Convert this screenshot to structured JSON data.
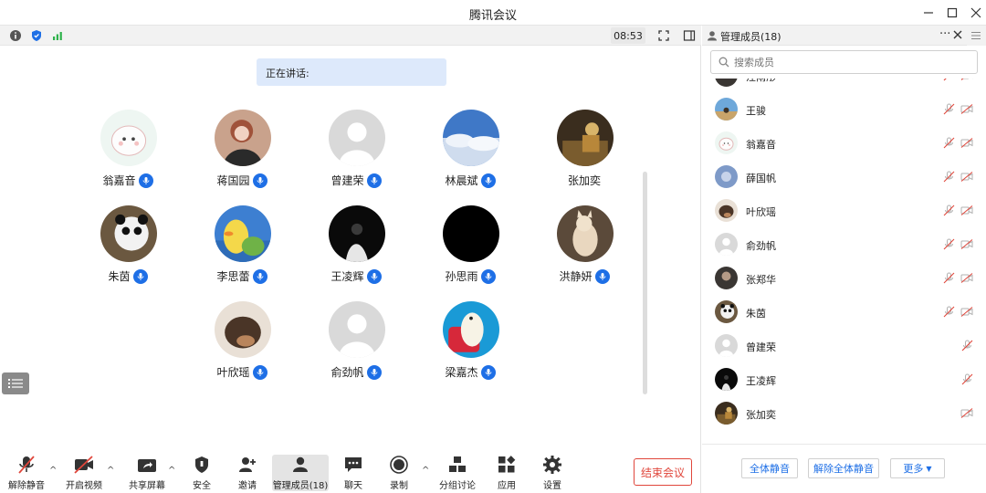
{
  "window": {
    "title": "腾讯会议"
  },
  "meeting": {
    "timer": "08:53",
    "speaking_label": "正在讲话:",
    "participants": [
      {
        "name": "翁嘉音",
        "mic": true,
        "avatar": "sheep"
      },
      {
        "name": "蒋国园",
        "mic": true,
        "avatar": "girl"
      },
      {
        "name": "曾建荣",
        "mic": true,
        "avatar": "default"
      },
      {
        "name": "林晨斌",
        "mic": true,
        "avatar": "clouds"
      },
      {
        "name": "张加奕",
        "mic": false,
        "avatar": "painting"
      },
      {
        "name": "朱茵",
        "mic": true,
        "avatar": "panda"
      },
      {
        "name": "李思蕾",
        "mic": true,
        "avatar": "duck"
      },
      {
        "name": "王凌辉",
        "mic": true,
        "avatar": "dark-person"
      },
      {
        "name": "孙思雨",
        "mic": true,
        "avatar": "black"
      },
      {
        "name": "洪静妍",
        "mic": true,
        "avatar": "cat"
      },
      {
        "name": "叶欣瑶",
        "mic": true,
        "avatar": "brown"
      },
      {
        "name": "俞劲帆",
        "mic": true,
        "avatar": "default"
      },
      {
        "name": "梁嘉杰",
        "mic": true,
        "avatar": "bird"
      }
    ]
  },
  "toolbar": {
    "unmute": "解除静音",
    "video": "开启视频",
    "share": "共享屏幕",
    "security": "安全",
    "invite": "邀请",
    "members": "管理成员(18)",
    "chat": "聊天",
    "record": "录制",
    "breakout": "分组讨论",
    "apps": "应用",
    "settings": "设置",
    "end": "结束会议"
  },
  "panel": {
    "title": "管理成员(18)",
    "search_placeholder": "搜索成员",
    "members": [
      {
        "name": "汪雨彤",
        "avatar": "dark",
        "mic_muted": true,
        "cam": true
      },
      {
        "name": "王骏",
        "avatar": "sky",
        "mic_muted": true,
        "cam": true
      },
      {
        "name": "翁嘉音",
        "avatar": "sheep",
        "mic_muted": true,
        "cam": true
      },
      {
        "name": "薛国帆",
        "avatar": "blue",
        "mic_muted": true,
        "cam": true
      },
      {
        "name": "叶欣瑶",
        "avatar": "brown",
        "mic_muted": true,
        "cam": true
      },
      {
        "name": "俞劲帆",
        "avatar": "default",
        "mic_muted": true,
        "cam": true
      },
      {
        "name": "张郑华",
        "avatar": "dark",
        "mic_muted": true,
        "cam": true
      },
      {
        "name": "朱茵",
        "avatar": "panda",
        "mic_muted": true,
        "cam": true
      },
      {
        "name": "曾建荣",
        "avatar": "default",
        "mic_muted": true,
        "cam": false
      },
      {
        "name": "王凌辉",
        "avatar": "dark-person",
        "mic_muted": true,
        "cam": false
      },
      {
        "name": "张加奕",
        "avatar": "painting",
        "mic_muted": false,
        "cam": true
      }
    ],
    "mute_all": "全体静音",
    "unmute_all": "解除全体静音",
    "more": "更多"
  }
}
